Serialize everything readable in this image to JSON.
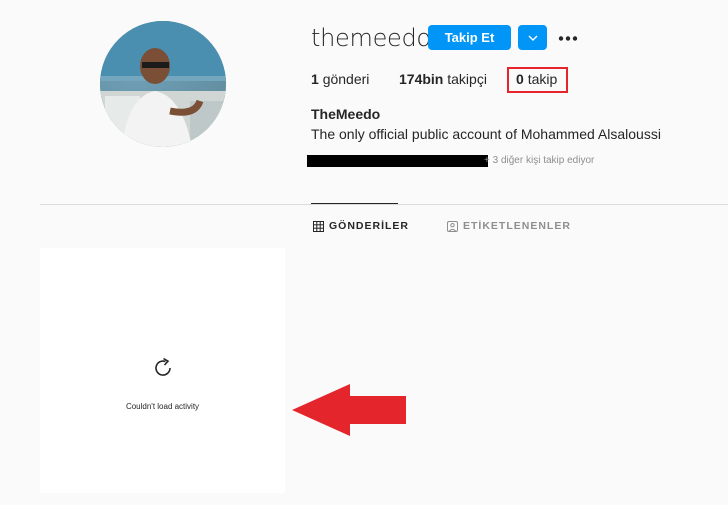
{
  "profile": {
    "username": "themeedo",
    "follow_label": "Takip Et",
    "full_name": "TheMeedo",
    "bio": "The only official public account of Mohammed Alsaloussi",
    "mutual_text": "+ 3 diğer kişi takip ediyor",
    "icons": {
      "dropdown": "chevron-down-icon",
      "more": "more-options-icon"
    }
  },
  "stats": {
    "posts_count": "1",
    "posts_label": "gönderi",
    "followers_count": "174bin",
    "followers_label": "takipçi",
    "following_count": "0",
    "following_label": "takip"
  },
  "tabs": [
    {
      "label": "GÖNDERİLER",
      "icon": "grid-icon",
      "active": true
    },
    {
      "label": "ETİKETLENENLER",
      "icon": "tagged-icon",
      "active": false
    }
  ],
  "activity": {
    "message": "Couldn't load activity",
    "icon": "reload-icon"
  },
  "annotations": {
    "highlight_color": "#e4252c",
    "arrow_color": "#e4252c"
  },
  "colors": {
    "accent": "#0095f6",
    "text": "#262626",
    "muted": "#8e8e8e"
  }
}
